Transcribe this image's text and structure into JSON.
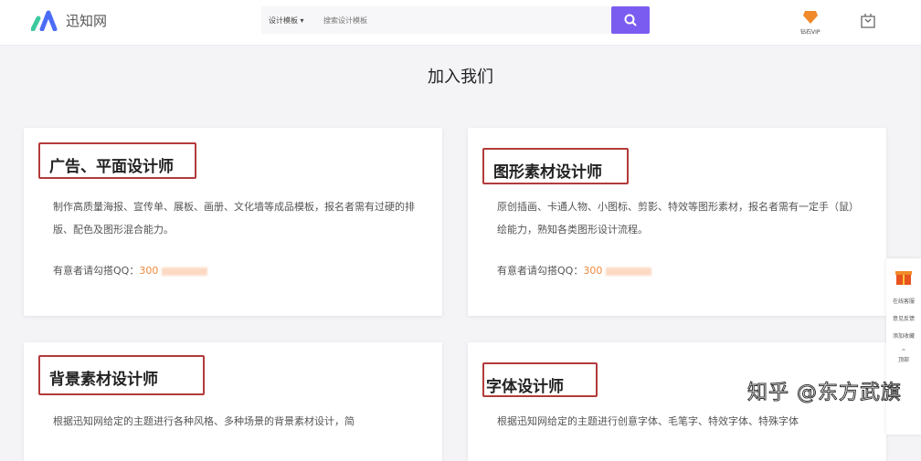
{
  "header": {
    "logo_text": "迅知网",
    "search_category": "设计模板",
    "search_placeholder": "搜索设计模板",
    "vip_label": "钻石VIP"
  },
  "page_title": "加入我们",
  "cards": [
    {
      "title": "广告、平面设计师",
      "desc": "制作高质量海报、宣传单、展板、画册、文化墙等成品模板，报名者需有过硬的排版、配色及图形混合能力。",
      "contact_label": "有意者请勾搭QQ：",
      "qq": "300"
    },
    {
      "title": "图形素材设计师",
      "desc": "原创插画、卡通人物、小图标、剪影、特效等图形素材，报名者需有一定手（鼠）绘能力，熟知各类图形设计流程。",
      "contact_label": "有意者请勾搭QQ：",
      "qq": "300"
    },
    {
      "title": "背景素材设计师",
      "desc": "根据迅知网给定的主题进行各种风格、多种场景的背景素材设计，简"
    },
    {
      "title": "字体设计师",
      "desc": "根据迅知网给定的主题进行创意字体、毛笔字、特效字体、特殊字体"
    }
  ],
  "side": {
    "items": [
      "在线客服",
      "意见反馈",
      "添加收藏",
      "顶部"
    ]
  },
  "watermark": "知乎 @东方武旗"
}
